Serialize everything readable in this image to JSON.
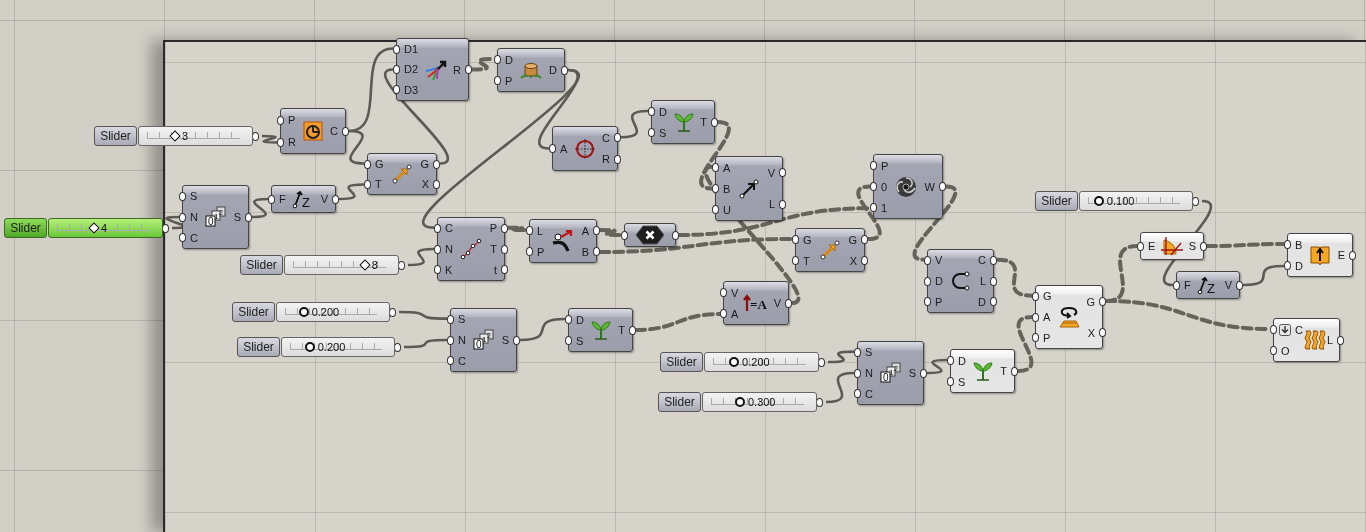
{
  "sliders": [
    {
      "label": "Slider",
      "value": "3",
      "kind": "integer",
      "level": 0.33,
      "selected": false
    },
    {
      "label": "Slider",
      "value": "4",
      "kind": "integer",
      "level": 0.41,
      "selected": true
    },
    {
      "label": "Slider",
      "value": "8",
      "kind": "integer",
      "level": 0.72,
      "selected": false
    },
    {
      "label": "Slider",
      "value": "0.200",
      "kind": "decimal",
      "level": 0.24,
      "selected": false
    },
    {
      "label": "Slider",
      "value": "0.200",
      "kind": "decimal",
      "level": 0.25,
      "selected": false
    },
    {
      "label": "Slider",
      "value": "0.200",
      "kind": "decimal",
      "level": 0.26,
      "selected": false
    },
    {
      "label": "Slider",
      "value": "0.300",
      "kind": "decimal",
      "level": 0.33,
      "selected": false
    },
    {
      "label": "Slider",
      "value": "0.100",
      "kind": "decimal",
      "level": 0.17,
      "selected": false
    }
  ],
  "components": [
    {
      "inputs": [
        "P",
        "R"
      ],
      "outputs": [
        "C"
      ],
      "preview": true
    },
    {
      "inputs": [
        "D1",
        "D2",
        "D3"
      ],
      "outputs": [
        "R"
      ],
      "preview": true
    },
    {
      "inputs": [
        "D",
        "P"
      ],
      "outputs": [
        "D"
      ],
      "preview": true
    },
    {
      "inputs": [
        "G",
        "T"
      ],
      "outputs": [
        "G",
        "X"
      ],
      "preview": true
    },
    {
      "inputs": [
        "S",
        "N",
        "C"
      ],
      "outputs": [
        "S"
      ],
      "icon_text": [
        "0",
        "1",
        "2"
      ],
      "preview": true
    },
    {
      "inputs": [
        "F"
      ],
      "outputs": [
        "V"
      ],
      "icon_text": [
        "Z"
      ],
      "preview": true
    },
    {
      "inputs": [
        "C",
        "N",
        "K"
      ],
      "outputs": [
        "P",
        "T",
        "t"
      ],
      "preview": true
    },
    {
      "inputs": [
        "A"
      ],
      "outputs": [
        "C",
        "R"
      ],
      "preview": true
    },
    {
      "inputs": [
        "D",
        "S"
      ],
      "outputs": [
        "T"
      ],
      "preview": true
    },
    {
      "inputs": [
        "A",
        "B",
        "U"
      ],
      "outputs": [
        "V",
        "L"
      ],
      "preview": true
    },
    {
      "inputs": [
        "L",
        "P"
      ],
      "outputs": [
        "A",
        "B"
      ],
      "preview": true
    },
    {
      "preview": true
    },
    {
      "inputs": [
        "P",
        "0",
        "1"
      ],
      "outputs": [
        "W"
      ],
      "preview": true
    },
    {
      "inputs": [
        "G",
        "T"
      ],
      "outputs": [
        "G",
        "X"
      ],
      "preview": true
    },
    {
      "inputs": [
        "V",
        "A"
      ],
      "outputs": [
        "V"
      ],
      "icon_text": [
        "=A"
      ],
      "preview": true
    },
    {
      "inputs": [
        "S",
        "N",
        "C"
      ],
      "outputs": [
        "S"
      ],
      "icon_text": [
        "0",
        "1",
        "2"
      ],
      "preview": true
    },
    {
      "inputs": [
        "D",
        "S"
      ],
      "outputs": [
        "T"
      ],
      "preview": true
    },
    {
      "inputs": [
        "V",
        "D",
        "P"
      ],
      "outputs": [
        "C",
        "L",
        "D"
      ],
      "preview": true
    },
    {
      "inputs": [
        "S",
        "N",
        "C"
      ],
      "outputs": [
        "S"
      ],
      "icon_text": [
        "0",
        "1",
        "2"
      ],
      "preview": true
    },
    {
      "inputs": [
        "D",
        "S"
      ],
      "outputs": [
        "T"
      ],
      "preview": false
    },
    {
      "inputs": [
        "G",
        "A",
        "P"
      ],
      "outputs": [
        "G",
        "X"
      ],
      "preview": false
    },
    {
      "inputs": [
        "E"
      ],
      "outputs": [
        "S"
      ],
      "preview": false
    },
    {
      "inputs": [
        "F"
      ],
      "outputs": [
        "V"
      ],
      "icon_text": [
        "Z"
      ],
      "preview": true
    },
    {
      "inputs": [
        "B",
        "D"
      ],
      "outputs": [
        "E"
      ],
      "preview": false
    },
    {
      "inputs": [
        "C",
        "O"
      ],
      "outputs": [
        "L"
      ],
      "input_flag": true,
      "preview": false
    }
  ]
}
